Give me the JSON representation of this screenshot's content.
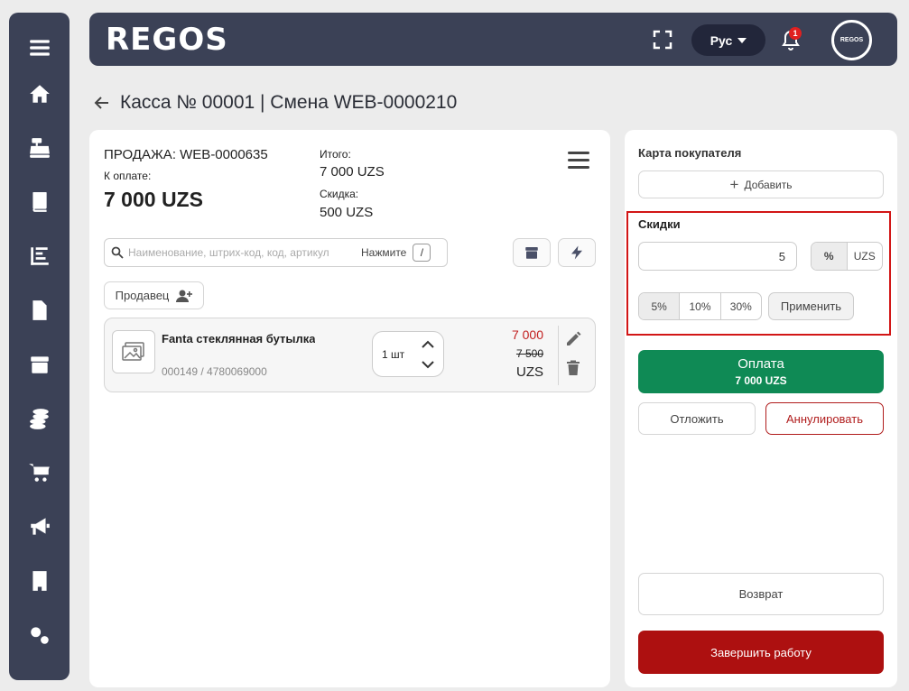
{
  "header": {
    "logo": "REGOS",
    "language": "Рус",
    "notifications_count": "1",
    "avatar_text": "REGOS"
  },
  "page": {
    "title": "Касса № 00001 | Смена WEB-0000210"
  },
  "sale": {
    "title": "ПРОДАЖА: WEB-0000635",
    "to_pay_label": "К оплате:",
    "to_pay_amount": "7 000 UZS",
    "total_label": "Итого:",
    "total_value": "7 000 UZS",
    "discount_label": "Скидка:",
    "discount_value": "500 UZS"
  },
  "search": {
    "placeholder": "Наименование, штрих-код, код, артикул",
    "press_label": "Нажмите",
    "shortcut": "/"
  },
  "seller_label": "Продавец",
  "items": [
    {
      "name": "Fanta стеклянная бутылка",
      "code": "000149  /  4780069000",
      "quantity": "1 шт",
      "price_new": "7 000",
      "price_old": "7 500",
      "currency": "UZS"
    }
  ],
  "right": {
    "customer_card_label": "Карта покупателя",
    "add_label": "Добавить",
    "discounts_label": "Скидки",
    "discount_input_value": "5",
    "unit_options": [
      "%",
      "UZS"
    ],
    "percent_presets": [
      "5%",
      "10%",
      "30%"
    ],
    "apply_label": "Применить",
    "pay_label": "Оплата",
    "pay_amount": "7 000 UZS",
    "postpone_label": "Отложить",
    "cancel_label": "Аннулировать",
    "return_label": "Возврат",
    "finish_label": "Завершить работу"
  },
  "sidebar": {
    "items": [
      "menu-icon",
      "home-icon",
      "cash-register-icon",
      "book-icon",
      "chart-icon",
      "document-icon",
      "box-icon",
      "coins-icon",
      "cart-icon",
      "megaphone-icon",
      "building-icon",
      "settings-icon"
    ]
  },
  "colors": {
    "sidebar_bg": "#3b4156",
    "pay_green": "#0f8a55",
    "finish_red": "#ad1010",
    "highlight_red": "#d21616"
  }
}
